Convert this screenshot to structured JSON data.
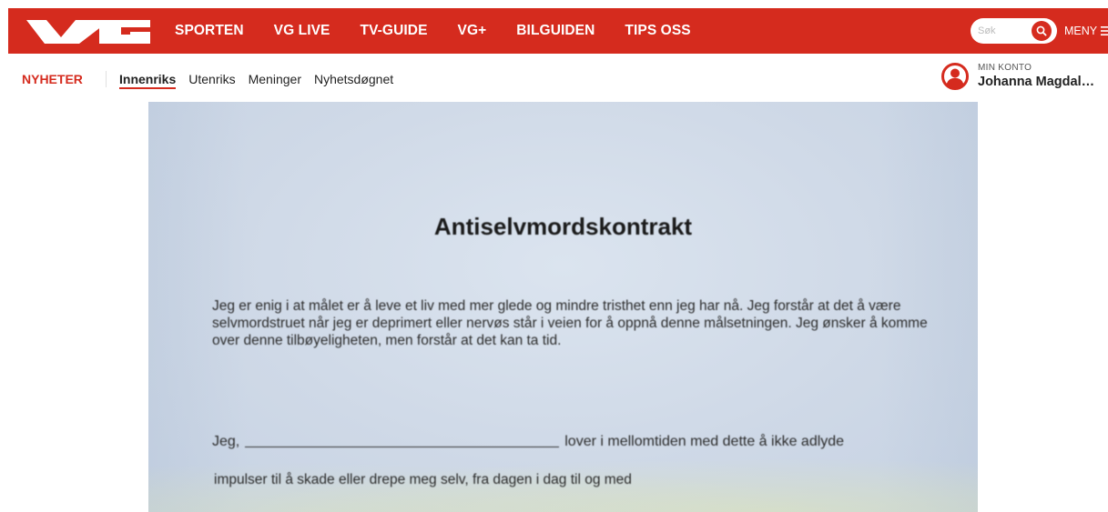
{
  "header": {
    "logo_text": "VG",
    "nav": [
      {
        "label": "SPORTEN"
      },
      {
        "label": "VG LIVE"
      },
      {
        "label": "TV-GUIDE"
      },
      {
        "label": "VG+"
      },
      {
        "label": "BILGUIDEN"
      },
      {
        "label": "TIPS OSS"
      }
    ],
    "search": {
      "placeholder": "Søk",
      "icon": "search-icon"
    },
    "menu": {
      "label": "MENY",
      "icon": "hamburger-icon"
    },
    "colors": {
      "brand_red": "#d52b1e"
    }
  },
  "subnav": {
    "section": "NYHETER",
    "links": [
      {
        "label": "Innenriks",
        "active": true
      },
      {
        "label": "Utenriks"
      },
      {
        "label": "Meninger"
      },
      {
        "label": "Nyhetsdøgnet"
      }
    ],
    "account": {
      "caption": "MIN KONTO",
      "name": "Johanna Magdal…",
      "icon": "user-avatar-icon"
    }
  },
  "article_image": {
    "title": "Antiselvmordskontrakt",
    "paragraph": "Jeg er enig i at målet er å leve et liv med mer glede og mindre tristhet enn jeg har nå. Jeg forstår at det å være selvmordstruet når jeg er deprimert eller nervøs står i veien for å oppnå denne målsetningen. Jeg ønsker å komme over denne tilbøyeligheten, men forstår at det kan ta tid.",
    "line1_start": "Jeg,",
    "line1_end": "lover i mellomtiden med dette å ikke adlyde",
    "line2": "impulser til å skade eller drepe meg selv, fra dagen i dag til og med"
  }
}
